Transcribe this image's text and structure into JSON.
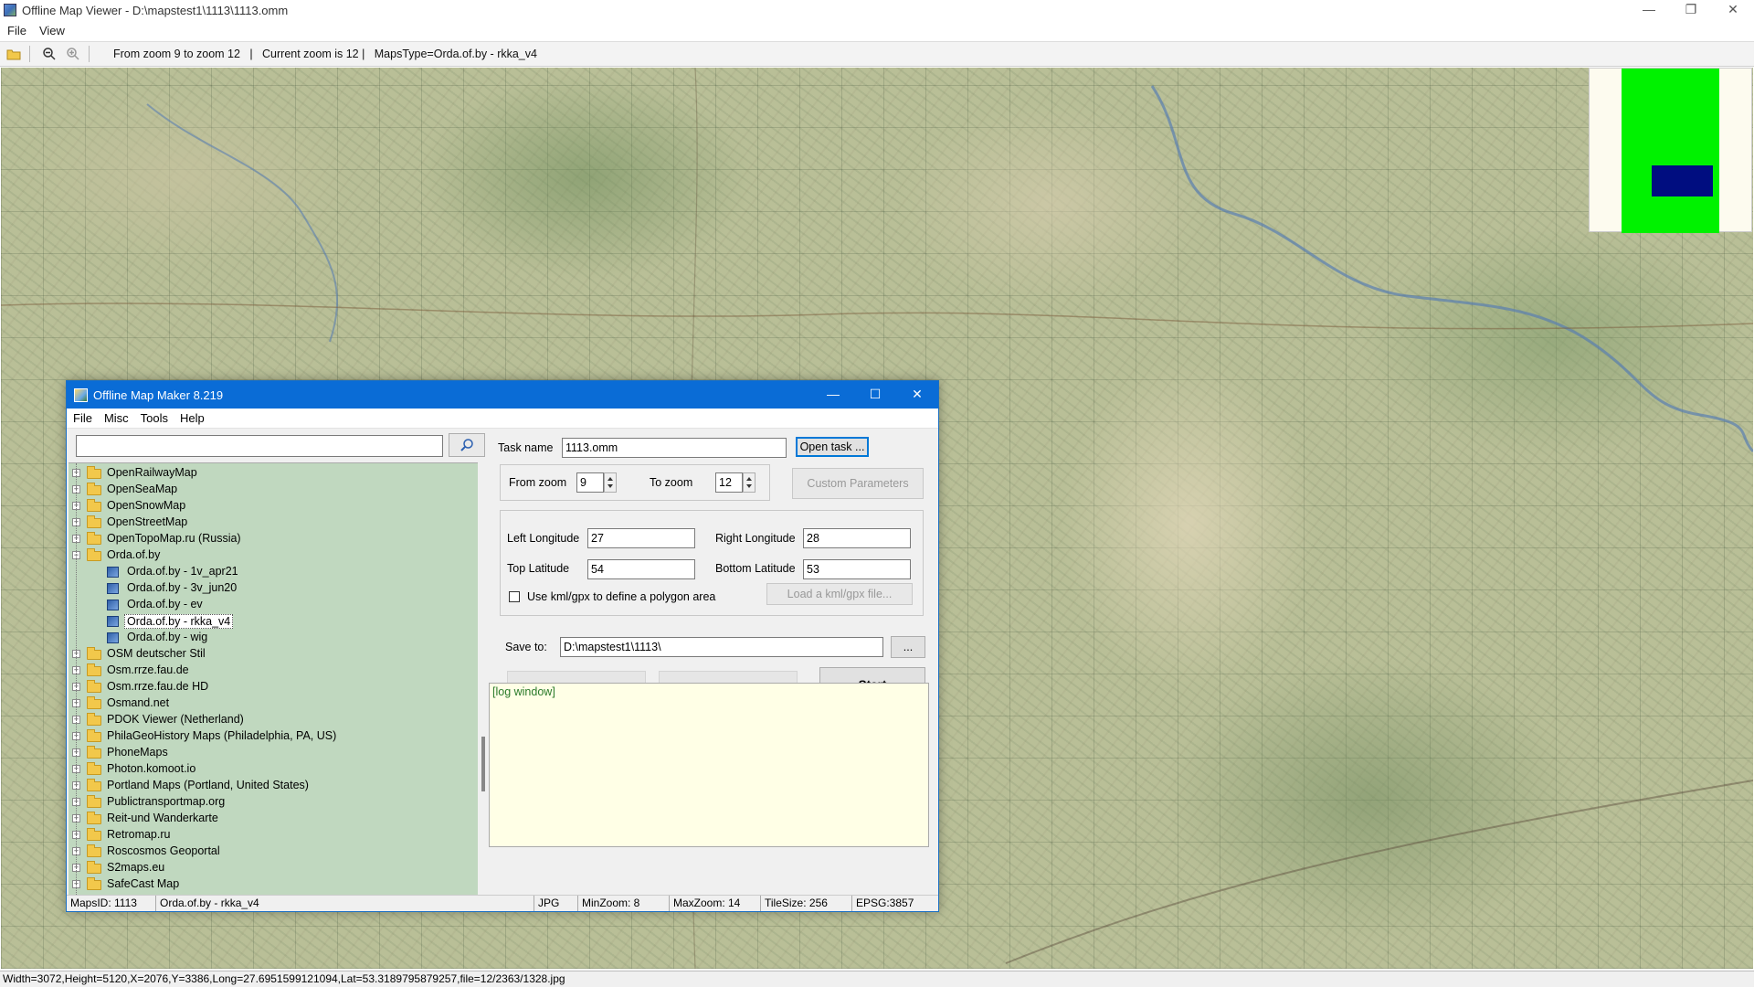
{
  "window": {
    "title": "Offline Map Viewer - D:\\mapstest1\\1113\\1113.omm",
    "min": "—",
    "max": "❐",
    "close": "✕"
  },
  "menu": {
    "file": "File",
    "view": "View"
  },
  "toolbar": {
    "zoom_range": "From zoom 9 to zoom 12   |   Current zoom is 12 |   MapsType=Orda.of.by - rkka_v4"
  },
  "minimap": {
    "frame_color": "#00f200",
    "viewport_color": "#000d80"
  },
  "statusbar": {
    "text": "Width=3072,Height=5120,X=2076,Y=3386,Long=27.6951599121094,Lat=53.3189795879257,file=12/2363/1328.jpg"
  },
  "dialog": {
    "title": "Offline Map Maker 8.219",
    "min": "—",
    "max": "☐",
    "close": "✕",
    "menu": {
      "file": "File",
      "misc": "Misc",
      "tools": "Tools",
      "help": "Help"
    },
    "search": {
      "value": ""
    },
    "tree": [
      {
        "label": "OpenRailwayMap",
        "type": "folder",
        "level": 0,
        "expanded": false
      },
      {
        "label": "OpenSeaMap",
        "type": "folder",
        "level": 0,
        "expanded": false
      },
      {
        "label": "OpenSnowMap",
        "type": "folder",
        "level": 0,
        "expanded": false
      },
      {
        "label": "OpenStreetMap",
        "type": "folder",
        "level": 0,
        "expanded": false
      },
      {
        "label": "OpenTopoMap.ru (Russia)",
        "type": "folder",
        "level": 0,
        "expanded": false
      },
      {
        "label": "Orda.of.by",
        "type": "folder",
        "level": 0,
        "expanded": true
      },
      {
        "label": "Orda.of.by - 1v_apr21",
        "type": "map",
        "level": 1
      },
      {
        "label": "Orda.of.by - 3v_jun20",
        "type": "map",
        "level": 1
      },
      {
        "label": "Orda.of.by - ev",
        "type": "map",
        "level": 1
      },
      {
        "label": "Orda.of.by - rkka_v4",
        "type": "map",
        "level": 1,
        "selected": true
      },
      {
        "label": "Orda.of.by - wig",
        "type": "map",
        "level": 1
      },
      {
        "label": "OSM deutscher Stil",
        "type": "folder",
        "level": 0,
        "expanded": false
      },
      {
        "label": "Osm.rrze.fau.de",
        "type": "folder",
        "level": 0,
        "expanded": false
      },
      {
        "label": "Osm.rrze.fau.de HD",
        "type": "folder",
        "level": 0,
        "expanded": false
      },
      {
        "label": "Osmand.net",
        "type": "folder",
        "level": 0,
        "expanded": false
      },
      {
        "label": "PDOK Viewer (Netherland)",
        "type": "folder",
        "level": 0,
        "expanded": false
      },
      {
        "label": "PhilaGeoHistory Maps (Philadelphia, PA, US)",
        "type": "folder",
        "level": 0,
        "expanded": false
      },
      {
        "label": "PhoneMaps",
        "type": "folder",
        "level": 0,
        "expanded": false
      },
      {
        "label": "Photon.komoot.io",
        "type": "folder",
        "level": 0,
        "expanded": false
      },
      {
        "label": "Portland Maps (Portland, United States)",
        "type": "folder",
        "level": 0,
        "expanded": false
      },
      {
        "label": "Publictransportmap.org",
        "type": "folder",
        "level": 0,
        "expanded": false
      },
      {
        "label": "Reit-und Wanderkarte",
        "type": "folder",
        "level": 0,
        "expanded": false
      },
      {
        "label": "Retromap.ru",
        "type": "folder",
        "level": 0,
        "expanded": false
      },
      {
        "label": "Roscosmos Geoportal",
        "type": "folder",
        "level": 0,
        "expanded": false
      },
      {
        "label": "S2maps.eu",
        "type": "folder",
        "level": 0,
        "expanded": false
      },
      {
        "label": "SafeCast Map",
        "type": "folder",
        "level": 0,
        "expanded": false
      }
    ],
    "form": {
      "task_name_label": "Task name",
      "task_name_value": "1113.omm",
      "open_task": "Open task ...",
      "from_zoom_label": "From zoom",
      "from_zoom_value": "9",
      "to_zoom_label": "To zoom",
      "to_zoom_value": "12",
      "custom_params": "Custom Parameters",
      "left_lon_label": "Left Longitude",
      "left_lon_value": "27",
      "right_lon_label": "Right Longitude",
      "right_lon_value": "28",
      "top_lat_label": "Top Latitude",
      "top_lat_value": "54",
      "bottom_lat_label": "Bottom Latitude",
      "bottom_lat_value": "53",
      "kml_label": "Use kml/gpx to define a polygon area",
      "load_kml": "Load a kml/gpx file...",
      "save_to_label": "Save to:",
      "save_to_value": "D:\\mapstest1\\1113\\",
      "browse": "...",
      "start": "Start"
    },
    "log": "[log window]",
    "status": {
      "maps_id": "MapsID: 1113",
      "map_name": "Orda.of.by - rkka_v4",
      "format": "JPG",
      "min_zoom": "MinZoom: 8",
      "max_zoom": "MaxZoom: 14",
      "tile_size": "TileSize: 256",
      "epsg": "EPSG:3857"
    }
  }
}
